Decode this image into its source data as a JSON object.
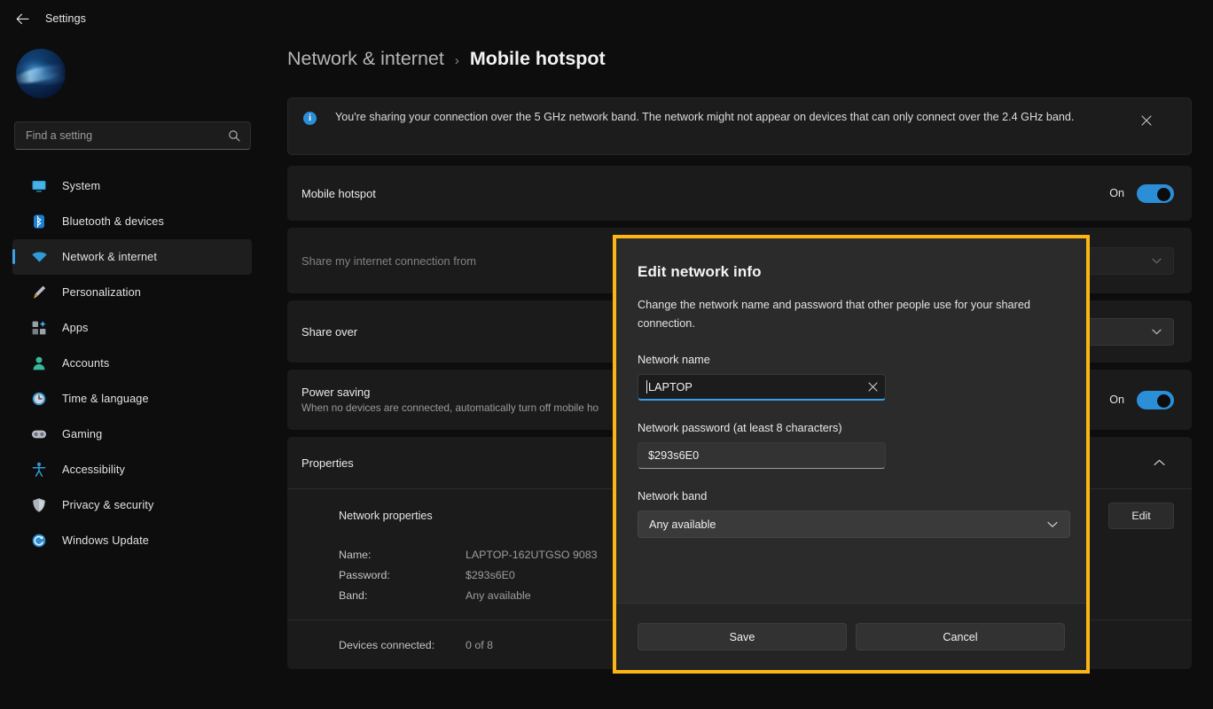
{
  "titlebar": {
    "back_icon": "arrow-left-icon",
    "title": "Settings"
  },
  "sidebar": {
    "avatar": "user-avatar",
    "search": {
      "placeholder": "Find a setting",
      "icon": "search-icon",
      "value": ""
    },
    "items": [
      {
        "label": "System",
        "icon": "monitor-icon",
        "selected": false
      },
      {
        "label": "Bluetooth & devices",
        "icon": "bluetooth-icon",
        "selected": false
      },
      {
        "label": "Network & internet",
        "icon": "wifi-icon",
        "selected": true
      },
      {
        "label": "Personalization",
        "icon": "paintbrush-icon",
        "selected": false
      },
      {
        "label": "Apps",
        "icon": "apps-grid-icon",
        "selected": false
      },
      {
        "label": "Accounts",
        "icon": "person-icon",
        "selected": false
      },
      {
        "label": "Time & language",
        "icon": "clock-icon",
        "selected": false
      },
      {
        "label": "Gaming",
        "icon": "gamepad-icon",
        "selected": false
      },
      {
        "label": "Accessibility",
        "icon": "accessibility-icon",
        "selected": false
      },
      {
        "label": "Privacy & security",
        "icon": "shield-icon",
        "selected": false
      },
      {
        "label": "Windows Update",
        "icon": "update-refresh-icon",
        "selected": false
      }
    ]
  },
  "breadcrumb": {
    "parent": "Network & internet",
    "separator": "›",
    "current": "Mobile hotspot"
  },
  "banner": {
    "icon": "info-icon",
    "glyph": "i",
    "text": "You're sharing your connection over the 5 GHz network band. The network might not appear on devices that can only connect over the 2.4 GHz band.",
    "close_icon": "close-icon"
  },
  "rows": {
    "hotspot": {
      "title": "Mobile hotspot",
      "state": "On",
      "toggle": "on"
    },
    "share_from": {
      "title": "Share my internet connection from",
      "value": "",
      "chevron": "chevron-down-icon",
      "disabled": true
    },
    "share_over": {
      "title": "Share over",
      "value": "",
      "chevron": "chevron-down-icon",
      "disabled": false
    },
    "power_saving": {
      "title": "Power saving",
      "subtitle": "When no devices are connected, automatically turn off mobile ho",
      "state": "On",
      "toggle": "on"
    },
    "properties": {
      "title": "Properties",
      "chevron": "chevron-up-icon",
      "expanded": true
    }
  },
  "properties_panel": {
    "heading": "Network properties",
    "edit_label": "Edit",
    "fields": [
      {
        "key": "Name:",
        "value": "LAPTOP-162UTGSO 9083"
      },
      {
        "key": "Password:",
        "value": "$293s6E0"
      },
      {
        "key": "Band:",
        "value": "Any available"
      }
    ],
    "devices": {
      "key": "Devices connected:",
      "value": "0 of 8"
    }
  },
  "dialog": {
    "highlight_color": "#fcb514",
    "title": "Edit network info",
    "description": "Change the network name and password that other people use for your shared connection.",
    "network_name": {
      "label": "Network name",
      "value": "LAPTOP",
      "clear_icon": "close-icon",
      "focused": true
    },
    "network_password": {
      "label": "Network password (at least 8 characters)",
      "value": "$293s6E0"
    },
    "network_band": {
      "label": "Network band",
      "value": "Any available",
      "chevron": "chevron-down-icon"
    },
    "save_label": "Save",
    "cancel_label": "Cancel"
  },
  "colors": {
    "accent": "#2b8fd8",
    "highlight": "#fcb514",
    "bg": "#0d0d0d",
    "card": "#1b1b1b"
  }
}
